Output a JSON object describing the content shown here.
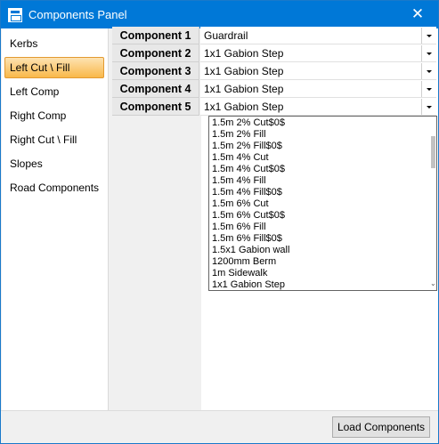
{
  "window": {
    "title": "Components Panel",
    "app_icon": "window-icon",
    "close_icon": "close-icon",
    "close_glyph": "✕"
  },
  "sidebar": {
    "selected": "Left Cut \\ Fill",
    "items": [
      {
        "label": "Kerbs"
      },
      {
        "label": "Left Cut \\ Fill"
      },
      {
        "label": "Left Comp"
      },
      {
        "label": "Right Comp"
      },
      {
        "label": "Right Cut \\ Fill"
      },
      {
        "label": "Slopes"
      },
      {
        "label": "Road Components"
      }
    ]
  },
  "components": [
    {
      "label": "Component 1",
      "value": "Guardrail"
    },
    {
      "label": "Component 2",
      "value": "1x1 Gabion Step"
    },
    {
      "label": "Component 3",
      "value": "1x1 Gabion Step"
    },
    {
      "label": "Component 4",
      "value": "1x1 Gabion Step"
    },
    {
      "label": "Component 5",
      "value": "1x1 Gabion Step"
    }
  ],
  "dropdown": {
    "options": [
      "1.5m 2% Cut$0$",
      "1.5m 2% Fill",
      "1.5m 2% Fill$0$",
      "1.5m 4% Cut",
      "1.5m 4% Cut$0$",
      "1.5m 4% Fill",
      "1.5m 4% Fill$0$",
      "1.5m 6% Cut",
      "1.5m 6% Cut$0$",
      "1.5m 6% Fill",
      "1.5m 6% Fill$0$",
      "1.5x1 Gabion wall",
      "1200mm Berm",
      "1m Sidewalk",
      "1x1 Gabion Step"
    ]
  },
  "footer": {
    "load_button": "Load Components"
  },
  "colors": {
    "titlebar": "#0078d7",
    "selected_item": "#f9b84a",
    "window_border": "#1979ca"
  }
}
